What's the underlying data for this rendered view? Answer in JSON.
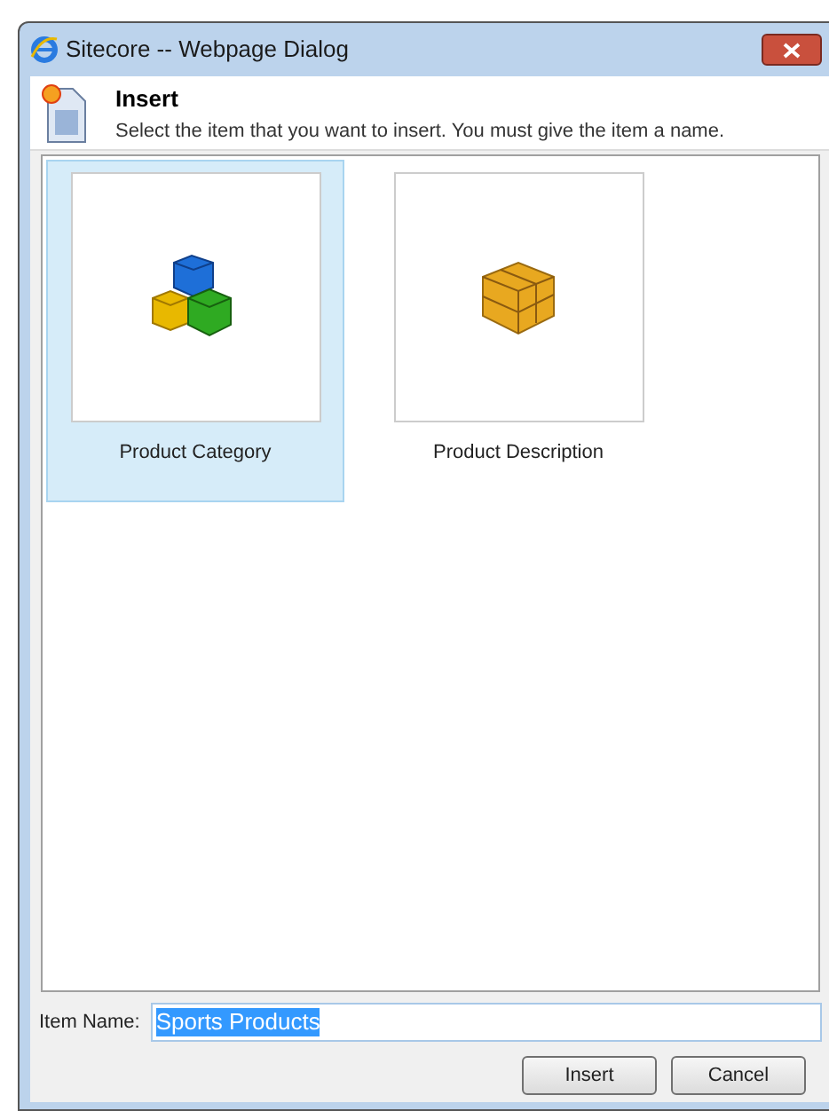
{
  "window": {
    "title": "Sitecore -- Webpage Dialog"
  },
  "header": {
    "title": "Insert",
    "description": "Select the item that you want to insert. You must give the item a name."
  },
  "items": [
    {
      "label": "Product Category",
      "kind": "blocks",
      "selected": true
    },
    {
      "label": "Product Description",
      "kind": "box",
      "selected": false
    }
  ],
  "item_name": {
    "label": "Item Name:",
    "value": "Sports Products",
    "value_selected": true
  },
  "buttons": [
    "Insert",
    "Cancel"
  ]
}
